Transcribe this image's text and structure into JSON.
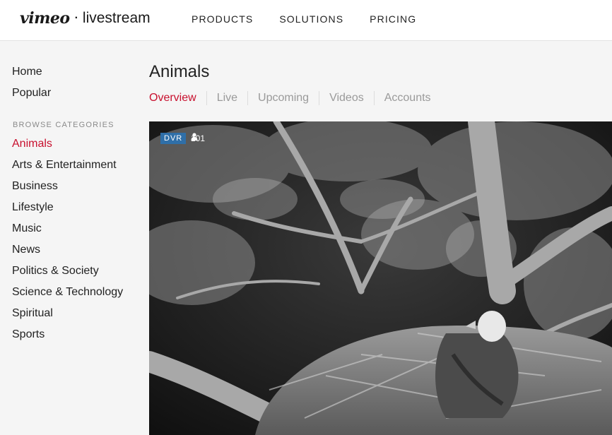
{
  "header": {
    "logo_primary": "vimeo",
    "logo_separator": "·",
    "logo_secondary": "livestream",
    "nav": [
      "PRODUCTS",
      "SOLUTIONS",
      "PRICING"
    ]
  },
  "sidebar": {
    "top_links": [
      "Home",
      "Popular"
    ],
    "categories_heading": "BROWSE CATEGORIES",
    "categories": [
      "Animals",
      "Arts & Entertainment",
      "Business",
      "Lifestyle",
      "Music",
      "News",
      "Politics & Society",
      "Science & Technology",
      "Spiritual",
      "Sports"
    ],
    "active_category": "Animals"
  },
  "main": {
    "title": "Animals",
    "tabs": [
      "Overview",
      "Live",
      "Upcoming",
      "Videos",
      "Accounts"
    ],
    "active_tab": "Overview"
  },
  "video": {
    "badge": "DVR",
    "viewer_count": "101",
    "viewer_icon": "person-icon"
  },
  "colors": {
    "accent": "#c8102e",
    "badge": "#2f6fa8"
  }
}
